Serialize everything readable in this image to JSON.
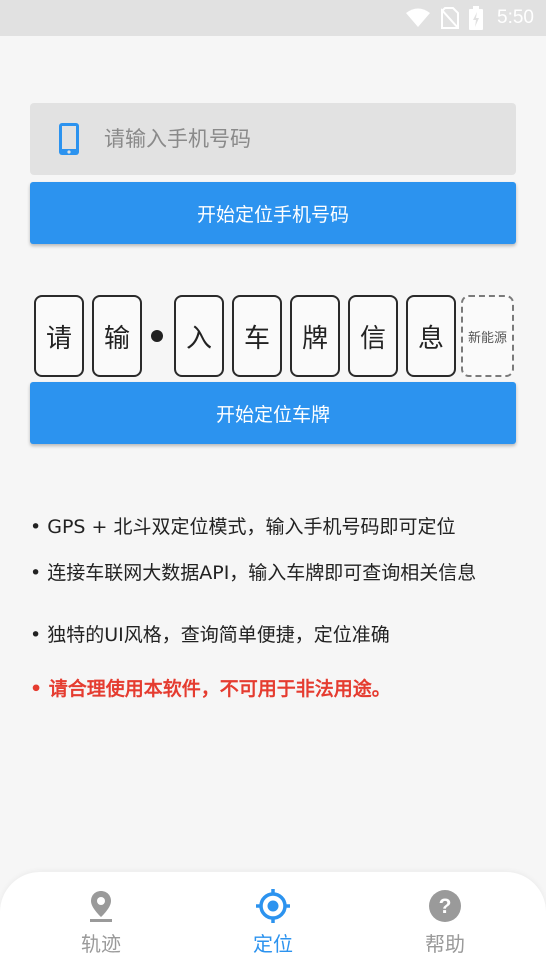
{
  "status_bar": {
    "time": "5:50",
    "icons": [
      "wifi-icon",
      "no-sim-icon",
      "battery-charging-icon"
    ]
  },
  "phone": {
    "icon": "phone-icon",
    "placeholder": "请输入手机号码",
    "value": "",
    "button_label": "开始定位手机号码"
  },
  "plate": {
    "chars": [
      "请",
      "输",
      "入",
      "车",
      "牌",
      "信",
      "息"
    ],
    "new_energy_label": "新能源",
    "button_label": "开始定位车牌"
  },
  "info": {
    "items": [
      "• GPS + 北斗双定位模式，输入手机号码即可定位",
      "• 连接车联网大数据API，输入车牌即可查询相关信息",
      "• 独特的UI风格，查询简单便捷，定位准确"
    ],
    "warning": "• 请合理使用本软件，不可用于非法用途。"
  },
  "nav": {
    "items": [
      {
        "label": "轨迹",
        "icon": "location-pin-icon",
        "active": false
      },
      {
        "label": "定位",
        "icon": "crosshair-icon",
        "active": true
      },
      {
        "label": "帮助",
        "icon": "help-icon",
        "active": false
      }
    ]
  },
  "colors": {
    "accent": "#2c93ef",
    "warning": "#e53c30",
    "status_bar": "#e1e1e1",
    "inactive": "#9a9a9a"
  }
}
